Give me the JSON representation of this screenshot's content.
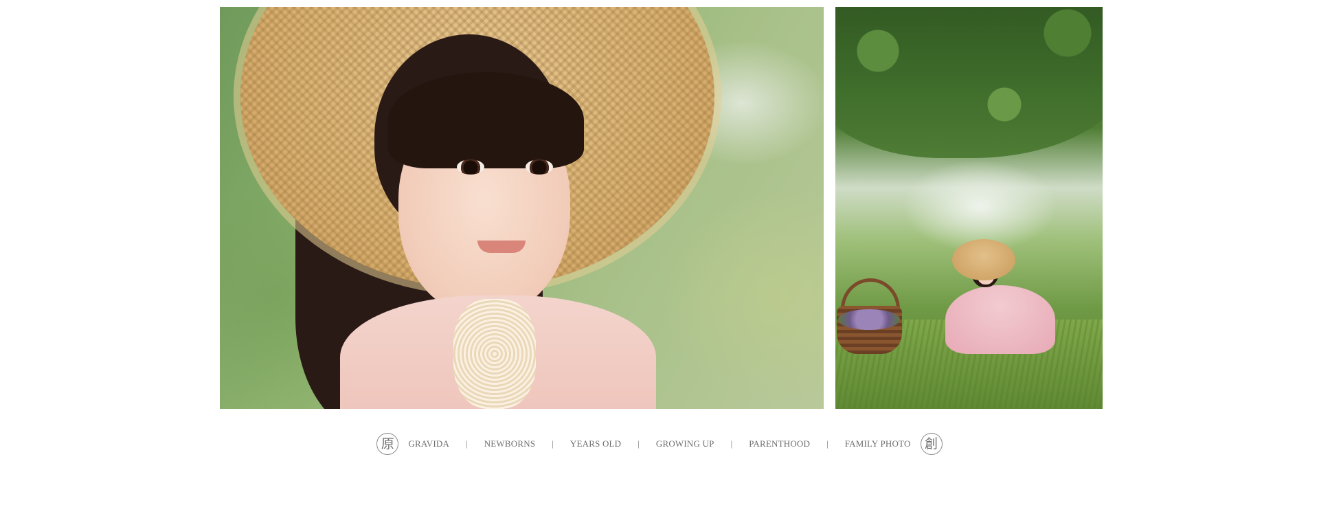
{
  "photos": [
    {
      "name": "girl-straw-hat-portrait"
    },
    {
      "name": "girl-sitting-under-tree"
    }
  ],
  "nav": {
    "left_seal": "原",
    "right_seal": "創",
    "items": [
      {
        "label": "GRAVIDA"
      },
      {
        "label": "NEWBORNS"
      },
      {
        "label": "YEARS OLD"
      },
      {
        "label": "GROWING UP"
      },
      {
        "label": "PARENTHOOD"
      },
      {
        "label": "FAMILY PHOTO"
      }
    ],
    "separator": "|"
  },
  "colors": {
    "background": "#ffffff",
    "nav_text": "#6e6e6e",
    "seal_border": "#8c8c8c"
  }
}
